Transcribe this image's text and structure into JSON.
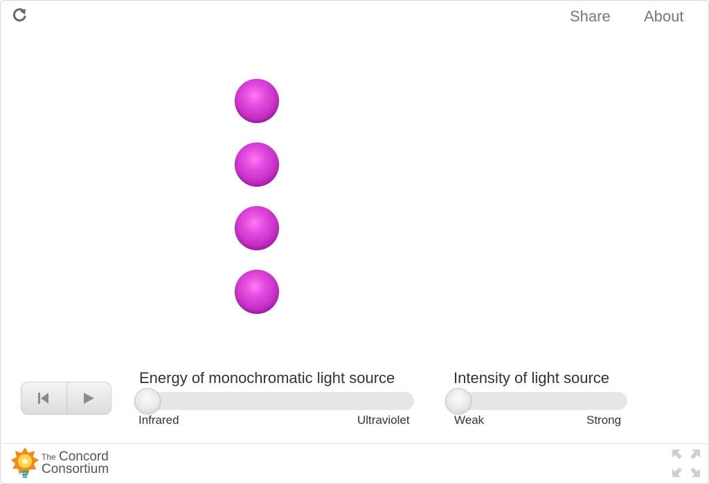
{
  "header": {
    "reload_icon": "reload-icon",
    "share_label": "Share",
    "about_label": "About"
  },
  "simulation": {
    "atom_count": 4,
    "atom_color": "#d83bd6"
  },
  "controls": {
    "reset_icon": "reset-icon",
    "play_icon": "play-icon"
  },
  "sliders": {
    "energy": {
      "title": "Energy of monochromatic light source",
      "min_label": "Infrared",
      "max_label": "Ultraviolet",
      "value_fraction": 0
    },
    "intensity": {
      "title": "Intensity of light source",
      "min_label": "Weak",
      "max_label": "Strong",
      "value_fraction": 0
    }
  },
  "footer": {
    "logo_small": "The",
    "logo_line1": "Concord",
    "logo_line2": "Consortium",
    "fullscreen_icon": "fullscreen-icon"
  },
  "colors": {
    "accent_orange": "#f28a1e",
    "text_gray": "#777777"
  }
}
